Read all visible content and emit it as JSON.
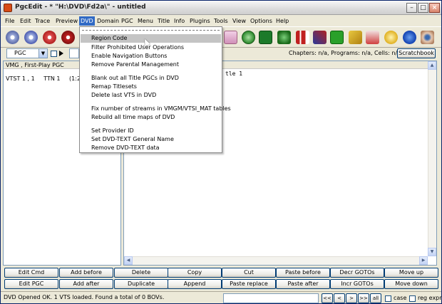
{
  "window": {
    "title": "PgcEdit - * \"H:\\DVD\\Fd2a\\\" - untitled"
  },
  "menu": [
    "File",
    "Edit",
    "Trace",
    "Preview",
    "DVD",
    "Domain",
    "PGC",
    "Menu",
    "Title",
    "Info",
    "Plugins",
    "Tools",
    "View",
    "Options",
    "Help"
  ],
  "toolbar2": {
    "domain_combo": "PGC",
    "stats": "Chapters: n/a,  Programs: n/a,  Cells: n/a",
    "scratchbook": "Scratchbook"
  },
  "left_panel": {
    "header": "VMG ,  First-Play PGC",
    "row": {
      "col1": "VTST 1 , 1",
      "col2": "TTN 1",
      "col3": "(1:2"
    }
  },
  "right_panel": {
    "line1": "tle 1"
  },
  "dvd_menu": {
    "items": [
      "Region Code",
      "Filter Prohibited User Operations",
      "Enable Navigation Buttons",
      "Remove Parental Management",
      "Blank out all Title PGCs in DVD",
      "Remap Titlesets",
      "Delete last VTS in DVD",
      "Fix number of streams in VMGM/VTSI_MAT tables",
      "Rebuild all time maps of DVD",
      "Set Provider ID",
      "Set DVD-TEXT General Name",
      "Remove DVD-TEXT data"
    ]
  },
  "buttons_row1": [
    "Edit Cmd",
    "Add before",
    "Delete",
    "Copy",
    "Cut",
    "Paste before",
    "Decr GOTOs",
    "Move up"
  ],
  "buttons_row2": [
    "Edit PGC",
    "Add after",
    "Duplicate",
    "Append",
    "Paste replace",
    "Paste after",
    "Incr GOTOs",
    "Move down"
  ],
  "status": {
    "text": "DVD Opened OK.  1 VTS loaded.    Found a total of 0 BOVs.",
    "nav": [
      "<<",
      "<",
      ">",
      ">>",
      "all"
    ],
    "case_label": "case",
    "regexpr_label": "reg expr"
  }
}
